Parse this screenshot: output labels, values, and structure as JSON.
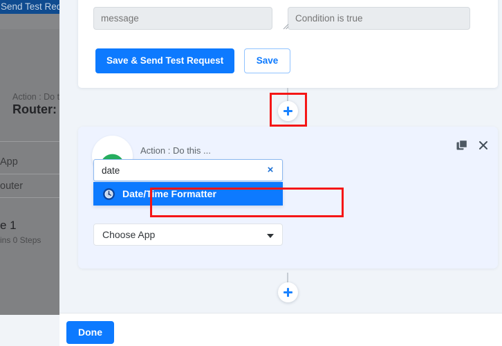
{
  "background_app": {
    "topbar_title": "Send Test Req",
    "action_label": "Action : Do t",
    "router_title": "Router: C",
    "choose_app_row": "App",
    "router_row": "outer",
    "route_title": "e 1",
    "route_subtitle": "ins 0 Steps"
  },
  "form_card": {
    "message_field": {
      "value": "",
      "placeholder": "message"
    },
    "condition_field": {
      "value": "",
      "placeholder": "Condition is true"
    },
    "save_send_label": "Save & Send Test Request",
    "save_label": "Save"
  },
  "action_card": {
    "header_label": "Action : Do this ...",
    "copy_icon": "duplicate-icon",
    "close_icon": "close-icon",
    "avatar_icon": "green-arc-icon",
    "search": {
      "value": "date",
      "placeholder": "",
      "clear_glyph": "×",
      "options": [
        {
          "label": "Date/Time Formatter",
          "icon": "clock-icon",
          "selected": true
        }
      ]
    },
    "choose_app": {
      "label": "Choose App",
      "caret_icon": "chevron-down-icon"
    }
  },
  "connectors": {
    "top_plus_label": "+",
    "bottom_plus_label": "+"
  },
  "footer": {
    "done_label": "Done"
  },
  "colors": {
    "accent_blue": "#0d7aff",
    "highlight_red": "#f51616",
    "card_blue": "#eef3ff",
    "page_bg": "#f0f4f9",
    "topbar_navy": "#0f4b8f",
    "avatar_green": "#26ad5f"
  }
}
